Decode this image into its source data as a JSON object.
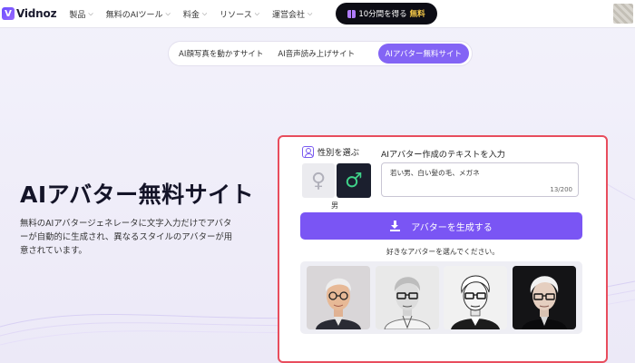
{
  "nav": {
    "logo_mark": "V",
    "logo_text": "Vidnoz",
    "menu": [
      {
        "label": "製品"
      },
      {
        "label": "無料のAIツール"
      },
      {
        "label": "料金"
      },
      {
        "label": "リソース"
      },
      {
        "label": "運営会社"
      }
    ],
    "promo": {
      "label": "10分間を得る",
      "highlight": "無料",
      "icon": "gift-icon"
    }
  },
  "tabs": [
    {
      "label": "AI顔写真を動かすサイト",
      "active": false
    },
    {
      "label": "AI音声読み上げサイト",
      "active": false
    },
    {
      "label": "AIアバター無料サイト",
      "active": true
    }
  ],
  "hero": {
    "title": "AIアバター無料サイト",
    "description": "無料のAIアバタージェネレータに文字入力だけでアバターが自動的に生成され、異なるスタイルのアバターが用意されています。"
  },
  "generator": {
    "gender_label": "性別を選ぶ",
    "gender_options": [
      {
        "symbol": "♀",
        "name": "female"
      },
      {
        "symbol": "♂",
        "name": "male"
      }
    ],
    "selected_gender": "男",
    "text_label": "AIアバター作成のテキストを入力",
    "text_value": "若い男、白い髪の毛、メガネ",
    "char_count": "13/200",
    "generate_label": "アバターを生成する",
    "choose_text": "好きなアバターを選んでください。"
  },
  "colors": {
    "accent": "#7a55f4",
    "highlight_border": "#e84d5d",
    "promo_free": "#f7c948",
    "male_symbol": "#3fd38a"
  }
}
